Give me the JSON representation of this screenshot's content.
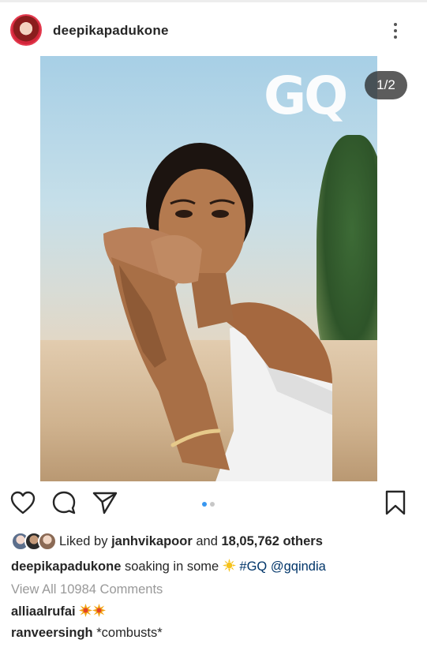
{
  "post": {
    "username": "deepikapadukone",
    "image_counter": "1/2",
    "image_logo_text": "GQ"
  },
  "likes": {
    "prefix": "Liked by",
    "liked_user": "janhvikapoor",
    "conjunction": "and",
    "others": "18,05,762 others"
  },
  "caption": {
    "username": "deepikapadukone",
    "text": "soaking in some",
    "hashtag": "#GQ",
    "mention": "@gqindia"
  },
  "comments": {
    "view_all": "View All 10984 Comments",
    "items": [
      {
        "username": "alliaalrufai",
        "text": ""
      },
      {
        "username": "ranveersingh",
        "text": "*combusts*"
      }
    ]
  },
  "icons": [
    "more-options-icon",
    "heart-icon",
    "comment-icon",
    "share-icon",
    "bookmark-icon",
    "sun-emoji-icon",
    "collision-emoji-icon"
  ],
  "colors": {
    "link": "#003569",
    "dot_active": "#3897f0",
    "muted": "#999999",
    "text": "#262626"
  }
}
